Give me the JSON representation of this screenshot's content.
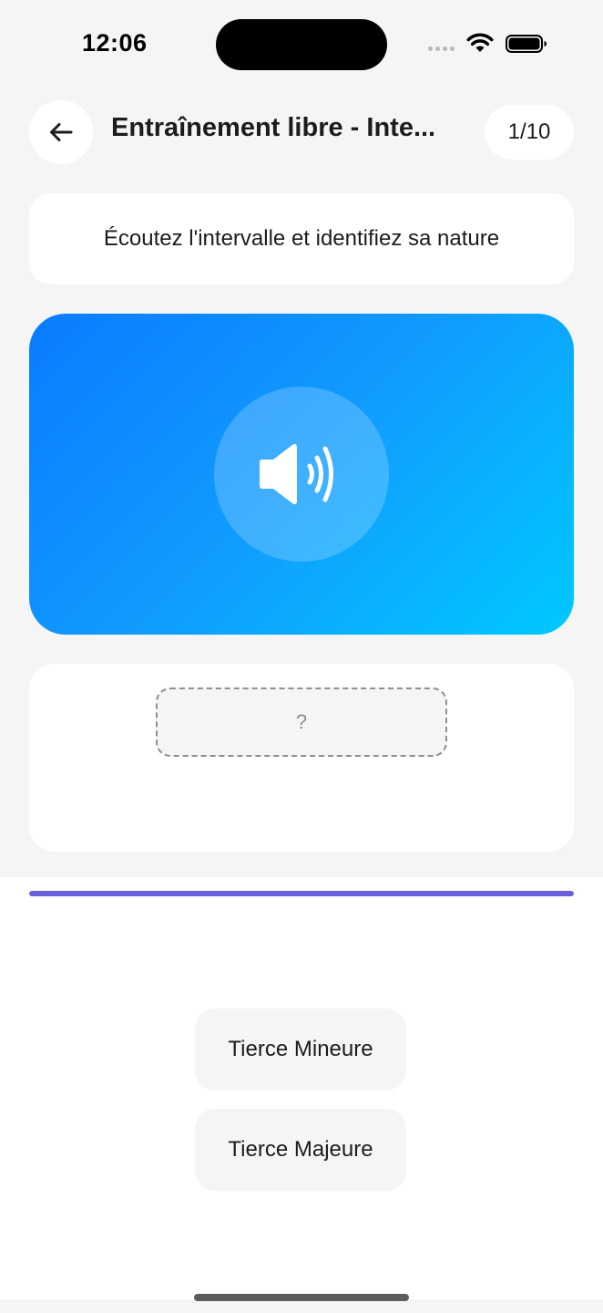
{
  "status_bar": {
    "time": "12:06"
  },
  "header": {
    "title": "Entraînement libre - Inte...",
    "progress": "1/10",
    "back_icon": "arrow-left-icon"
  },
  "instruction": {
    "text": "Écoutez l'intervalle et identifiez sa nature"
  },
  "audio": {
    "icon": "speaker-wave-icon",
    "gradient_start": "#0a7cff",
    "gradient_end": "#00c8ff"
  },
  "answer": {
    "placeholder": "?"
  },
  "progress_bar": {
    "fraction": 1.0,
    "color": "#6a5fdc"
  },
  "choices": [
    {
      "label": "Tierce Mineure"
    },
    {
      "label": "Tierce Majeure"
    }
  ],
  "colors": {
    "background": "#f5f5f5",
    "card": "#ffffff",
    "text": "#1c1c1e",
    "accent": "#6a5fdc"
  }
}
